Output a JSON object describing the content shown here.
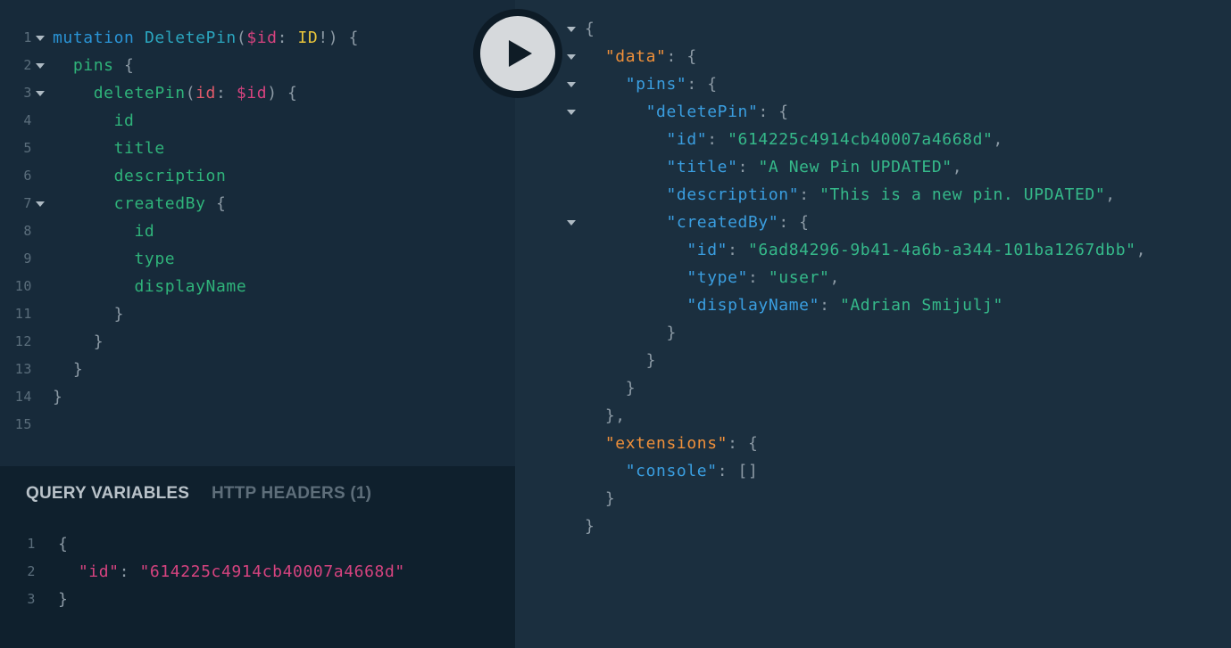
{
  "run_button": {
    "icon": "play-icon"
  },
  "query_editor": {
    "lines": [
      {
        "n": "1",
        "fold": true,
        "tokens": [
          {
            "t": "mutation ",
            "c": "kw"
          },
          {
            "t": "DeletePin",
            "c": "op"
          },
          {
            "t": "(",
            "c": "punc"
          },
          {
            "t": "$id",
            "c": "var"
          },
          {
            "t": ": ",
            "c": "punc"
          },
          {
            "t": "ID",
            "c": "type"
          },
          {
            "t": "!) {",
            "c": "punc"
          }
        ]
      },
      {
        "n": "2",
        "fold": true,
        "tokens": [
          {
            "t": "  pins",
            "c": "fld"
          },
          {
            "t": " {",
            "c": "punc"
          }
        ]
      },
      {
        "n": "3",
        "fold": true,
        "tokens": [
          {
            "t": "    deletePin",
            "c": "fld"
          },
          {
            "t": "(",
            "c": "punc"
          },
          {
            "t": "id",
            "c": "arg"
          },
          {
            "t": ": ",
            "c": "punc"
          },
          {
            "t": "$id",
            "c": "var"
          },
          {
            "t": ") {",
            "c": "punc"
          }
        ]
      },
      {
        "n": "4",
        "fold": false,
        "tokens": [
          {
            "t": "      id",
            "c": "fld"
          }
        ]
      },
      {
        "n": "5",
        "fold": false,
        "tokens": [
          {
            "t": "      title",
            "c": "fld"
          }
        ]
      },
      {
        "n": "6",
        "fold": false,
        "tokens": [
          {
            "t": "      description",
            "c": "fld"
          }
        ]
      },
      {
        "n": "7",
        "fold": true,
        "tokens": [
          {
            "t": "      createdBy",
            "c": "fld"
          },
          {
            "t": " {",
            "c": "punc"
          }
        ]
      },
      {
        "n": "8",
        "fold": false,
        "tokens": [
          {
            "t": "        id",
            "c": "fld"
          }
        ]
      },
      {
        "n": "9",
        "fold": false,
        "tokens": [
          {
            "t": "        type",
            "c": "fld"
          }
        ]
      },
      {
        "n": "10",
        "fold": false,
        "tokens": [
          {
            "t": "        displayName",
            "c": "fld"
          }
        ]
      },
      {
        "n": "11",
        "fold": false,
        "tokens": [
          {
            "t": "      }",
            "c": "punc"
          }
        ]
      },
      {
        "n": "12",
        "fold": false,
        "tokens": [
          {
            "t": "    }",
            "c": "punc"
          }
        ]
      },
      {
        "n": "13",
        "fold": false,
        "tokens": [
          {
            "t": "  }",
            "c": "punc"
          }
        ]
      },
      {
        "n": "14",
        "fold": false,
        "tokens": [
          {
            "t": "}",
            "c": "punc"
          }
        ]
      },
      {
        "n": "15",
        "fold": false,
        "tokens": []
      }
    ]
  },
  "tabs": {
    "query_variables": "QUERY VARIABLES",
    "http_headers": "HTTP HEADERS (1)"
  },
  "variables_editor": {
    "lines": [
      {
        "n": "1",
        "tokens": [
          {
            "t": "{",
            "c": "punc"
          }
        ]
      },
      {
        "n": "2",
        "tokens": [
          {
            "t": "  \"id\"",
            "c": "vkey"
          },
          {
            "t": ": ",
            "c": "punc"
          },
          {
            "t": "\"614225c4914cb40007a4668d\"",
            "c": "vstr"
          }
        ]
      },
      {
        "n": "3",
        "tokens": [
          {
            "t": "}",
            "c": "punc"
          }
        ]
      }
    ]
  },
  "result_viewer": {
    "lines": [
      {
        "fold": true,
        "tokens": [
          {
            "t": "{",
            "c": "punc"
          }
        ]
      },
      {
        "fold": true,
        "tokens": [
          {
            "t": "  ",
            "c": "punc"
          },
          {
            "t": "\"data\"",
            "c": "okey"
          },
          {
            "t": ": {",
            "c": "punc"
          }
        ]
      },
      {
        "fold": true,
        "tokens": [
          {
            "t": "    ",
            "c": "punc"
          },
          {
            "t": "\"pins\"",
            "c": "key"
          },
          {
            "t": ": {",
            "c": "punc"
          }
        ]
      },
      {
        "fold": true,
        "tokens": [
          {
            "t": "      ",
            "c": "punc"
          },
          {
            "t": "\"deletePin\"",
            "c": "key"
          },
          {
            "t": ": {",
            "c": "punc"
          }
        ]
      },
      {
        "fold": false,
        "tokens": [
          {
            "t": "        ",
            "c": "punc"
          },
          {
            "t": "\"id\"",
            "c": "key"
          },
          {
            "t": ": ",
            "c": "punc"
          },
          {
            "t": "\"614225c4914cb40007a4668d\"",
            "c": "str"
          },
          {
            "t": ",",
            "c": "punc"
          }
        ]
      },
      {
        "fold": false,
        "tokens": [
          {
            "t": "        ",
            "c": "punc"
          },
          {
            "t": "\"title\"",
            "c": "key"
          },
          {
            "t": ": ",
            "c": "punc"
          },
          {
            "t": "\"A New Pin UPDATED\"",
            "c": "str"
          },
          {
            "t": ",",
            "c": "punc"
          }
        ]
      },
      {
        "fold": false,
        "tokens": [
          {
            "t": "        ",
            "c": "punc"
          },
          {
            "t": "\"description\"",
            "c": "key"
          },
          {
            "t": ": ",
            "c": "punc"
          },
          {
            "t": "\"This is a new pin. UPDATED\"",
            "c": "str"
          },
          {
            "t": ",",
            "c": "punc"
          }
        ]
      },
      {
        "fold": true,
        "tokens": [
          {
            "t": "        ",
            "c": "punc"
          },
          {
            "t": "\"createdBy\"",
            "c": "key"
          },
          {
            "t": ": {",
            "c": "punc"
          }
        ]
      },
      {
        "fold": false,
        "tokens": [
          {
            "t": "          ",
            "c": "punc"
          },
          {
            "t": "\"id\"",
            "c": "key"
          },
          {
            "t": ": ",
            "c": "punc"
          },
          {
            "t": "\"6ad84296-9b41-4a6b-a344-101ba1267dbb\"",
            "c": "str"
          },
          {
            "t": ",",
            "c": "punc"
          }
        ]
      },
      {
        "fold": false,
        "tokens": [
          {
            "t": "          ",
            "c": "punc"
          },
          {
            "t": "\"type\"",
            "c": "key"
          },
          {
            "t": ": ",
            "c": "punc"
          },
          {
            "t": "\"user\"",
            "c": "str"
          },
          {
            "t": ",",
            "c": "punc"
          }
        ]
      },
      {
        "fold": false,
        "tokens": [
          {
            "t": "          ",
            "c": "punc"
          },
          {
            "t": "\"displayName\"",
            "c": "key"
          },
          {
            "t": ": ",
            "c": "punc"
          },
          {
            "t": "\"Adrian Smijulj\"",
            "c": "str"
          }
        ]
      },
      {
        "fold": false,
        "tokens": [
          {
            "t": "        }",
            "c": "punc"
          }
        ]
      },
      {
        "fold": false,
        "tokens": [
          {
            "t": "      }",
            "c": "punc"
          }
        ]
      },
      {
        "fold": false,
        "tokens": [
          {
            "t": "    }",
            "c": "punc"
          }
        ]
      },
      {
        "fold": false,
        "tokens": [
          {
            "t": "  },",
            "c": "punc"
          }
        ]
      },
      {
        "fold": false,
        "tokens": [
          {
            "t": "  ",
            "c": "punc"
          },
          {
            "t": "\"extensions\"",
            "c": "okey"
          },
          {
            "t": ": {",
            "c": "punc"
          }
        ]
      },
      {
        "fold": false,
        "tokens": [
          {
            "t": "    ",
            "c": "punc"
          },
          {
            "t": "\"console\"",
            "c": "key"
          },
          {
            "t": ": []",
            "c": "punc"
          }
        ]
      },
      {
        "fold": false,
        "tokens": [
          {
            "t": "  }",
            "c": "punc"
          }
        ]
      },
      {
        "fold": false,
        "tokens": [
          {
            "t": "}",
            "c": "punc"
          }
        ]
      }
    ]
  },
  "colors": {
    "editor_bg": "#172a3a",
    "variables_bg": "#0f202d",
    "result_bg": "#1b2f3f",
    "tab_active": "#b9c2c9",
    "tab_inactive": "#5e6e7a",
    "run_button": "#d6d9dc"
  }
}
